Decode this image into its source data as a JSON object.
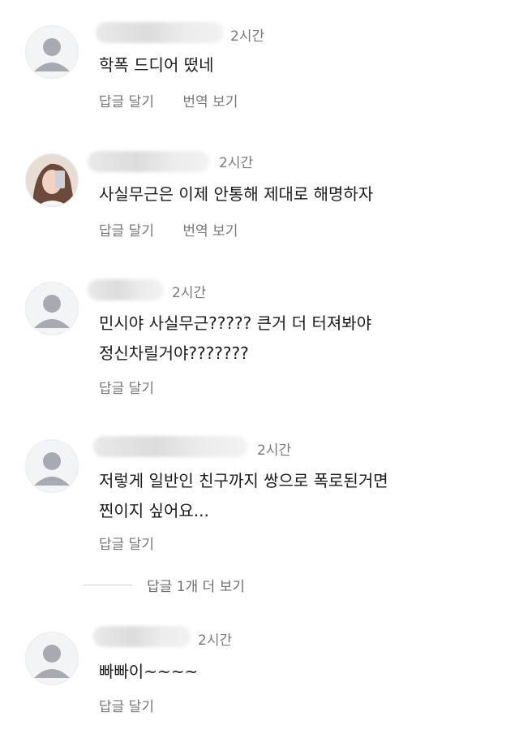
{
  "comments": [
    {
      "time": "2시간",
      "text": [
        "학폭 드디어 떴네"
      ],
      "reply_label": "답글 달기",
      "translate_label": "번역 보기"
    },
    {
      "time": "2시간",
      "text": [
        "사실무근은 이제 안통해 제대로 해명하자"
      ],
      "reply_label": "답글 달기",
      "translate_label": "번역 보기"
    },
    {
      "time": "2시간",
      "text": [
        "민시야 사실무근????? 큰거 더 터져봐야",
        "정신차릴거야???????"
      ],
      "reply_label": "답글 달기"
    },
    {
      "time": "2시간",
      "text": [
        "저렇게 일반인 친구까지 쌍으로 폭로된거면",
        "찐이지 싶어요..."
      ],
      "reply_label": "답글 달기"
    },
    {
      "time": "2시간",
      "text": [
        "빠빠이~~~~"
      ],
      "reply_label": "답글 달기"
    }
  ],
  "more_replies": "답글 1개 더 보기"
}
